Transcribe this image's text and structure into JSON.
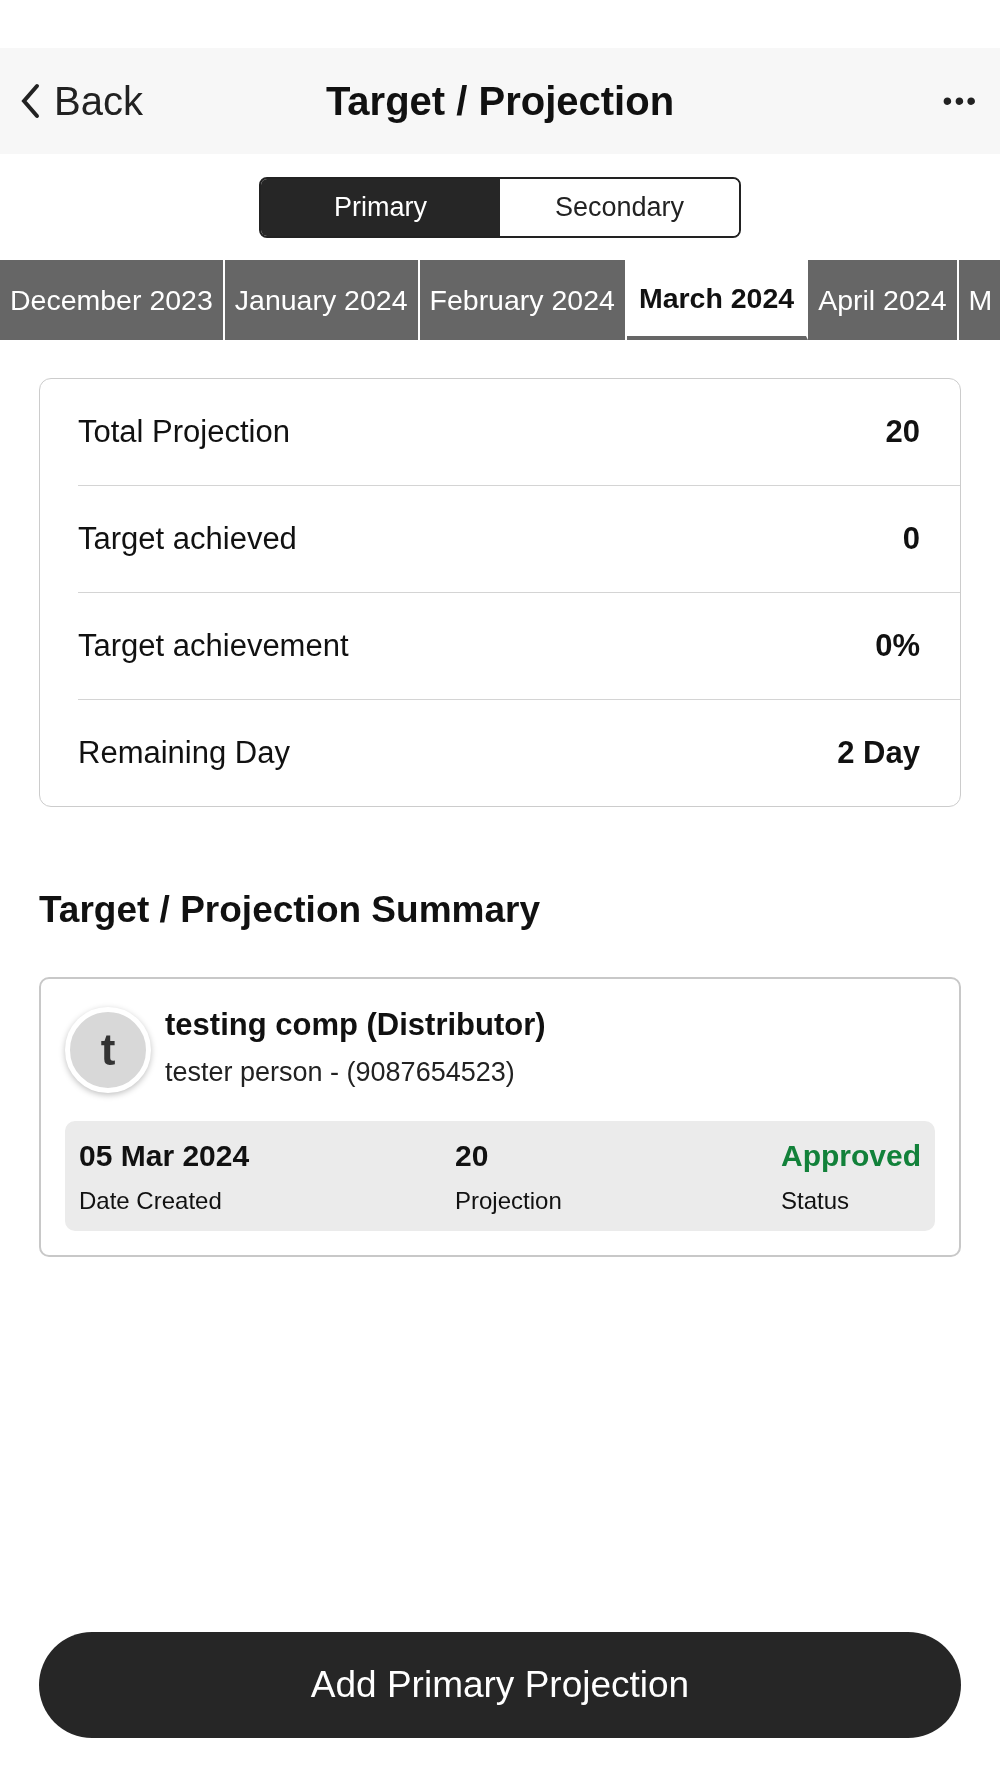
{
  "nav": {
    "back": "Back",
    "title": "Target / Projection",
    "more": "•••"
  },
  "segments": [
    {
      "label": "Primary",
      "selected": true
    },
    {
      "label": "Secondary",
      "selected": false
    }
  ],
  "months": [
    {
      "label": "December 2023",
      "selected": false
    },
    {
      "label": "January 2024",
      "selected": false
    },
    {
      "label": "February 2024",
      "selected": false
    },
    {
      "label": "March 2024",
      "selected": true
    },
    {
      "label": "April 2024",
      "selected": false
    },
    {
      "label": "M",
      "selected": false
    }
  ],
  "stats": [
    {
      "label": "Total Projection",
      "value": "20"
    },
    {
      "label": "Target achieved",
      "value": "0"
    },
    {
      "label": "Target achievement",
      "value": "0%"
    },
    {
      "label": "Remaining Day",
      "value": "2 Day"
    }
  ],
  "summary": {
    "title": "Target / Projection Summary",
    "entries": [
      {
        "initial": "t",
        "name": "testing comp (Distributor)",
        "contact": "tester person - (9087654523)",
        "fields": [
          {
            "value": "05 Mar 2024",
            "label": "Date Created",
            "kind": "plain"
          },
          {
            "value": "20",
            "label": "Projection",
            "kind": "plain"
          },
          {
            "value": "Approved",
            "label": "Status",
            "kind": "approved"
          }
        ]
      }
    ]
  },
  "action_button": "Add Primary Projection"
}
